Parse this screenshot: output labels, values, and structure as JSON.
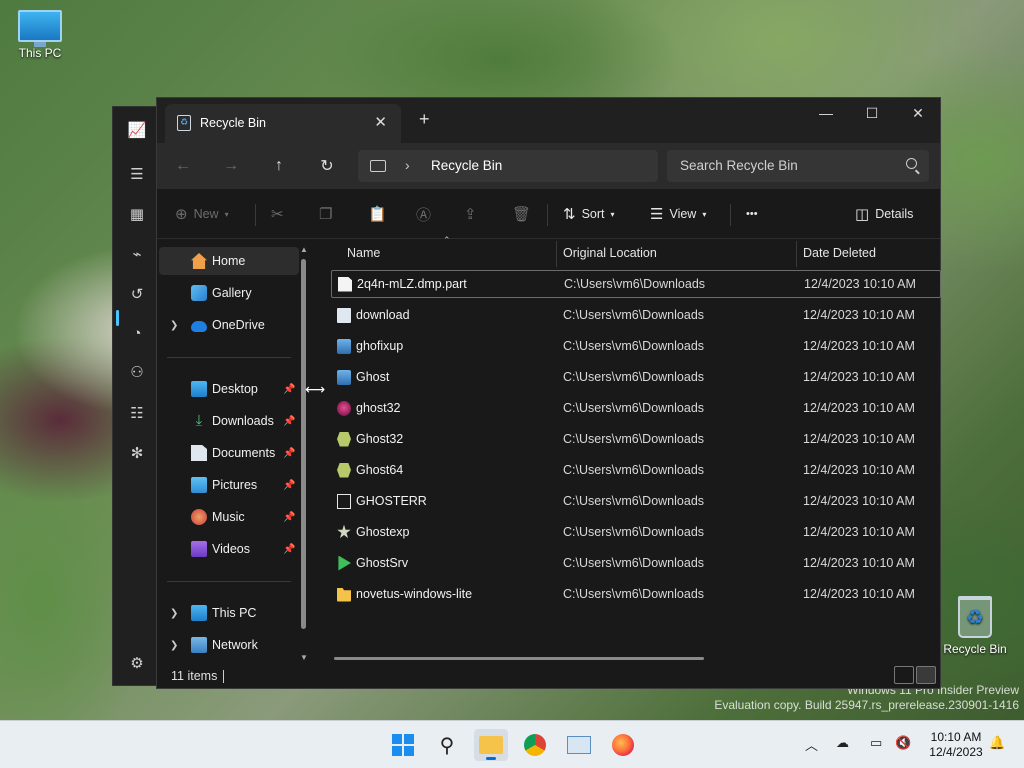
{
  "desktop": {
    "icons": [
      {
        "label": "This PC",
        "icon": "monitor-icon"
      },
      {
        "label": "Recycle Bin",
        "icon": "recycle-bin-icon"
      }
    ]
  },
  "watermark": {
    "line1": "Windows 11 Pro Insider Preview",
    "line2": "Evaluation copy. Build 25947.rs_prerelease.230901-1416"
  },
  "explorer": {
    "tab_title": "Recycle Bin",
    "address": {
      "location": "Recycle Bin"
    },
    "search_placeholder": "Search Recycle Bin",
    "toolbar": {
      "new_label": "New",
      "sort_label": "Sort",
      "view_label": "View",
      "more_label": "•••",
      "details_label": "Details"
    },
    "nav": {
      "items": [
        {
          "label": "Home",
          "icon": "home-icon",
          "active": true
        },
        {
          "label": "Gallery",
          "icon": "gallery-icon"
        },
        {
          "label": "OneDrive",
          "icon": "onedrive-icon",
          "expandable": true
        },
        {
          "label": "Desktop",
          "icon": "desktop-icon",
          "pinned": true
        },
        {
          "label": "Downloads",
          "icon": "downloads-icon",
          "pinned": true
        },
        {
          "label": "Documents",
          "icon": "documents-icon",
          "pinned": true
        },
        {
          "label": "Pictures",
          "icon": "pictures-icon",
          "pinned": true
        },
        {
          "label": "Music",
          "icon": "music-icon",
          "pinned": true
        },
        {
          "label": "Videos",
          "icon": "videos-icon",
          "pinned": true
        },
        {
          "label": "This PC",
          "icon": "this-pc-icon",
          "expandable": true
        },
        {
          "label": "Network",
          "icon": "network-icon",
          "expandable": true
        }
      ]
    },
    "columns": {
      "name": "Name",
      "location": "Original Location",
      "date": "Date Deleted"
    },
    "files": [
      {
        "name": "2q4n-mLZ.dmp.part",
        "location": "C:\\Users\\vm6\\Downloads",
        "date": "12/4/2023 10:10 AM",
        "icon": "file-icon"
      },
      {
        "name": "download",
        "location": "C:\\Users\\vm6\\Downloads",
        "date": "12/4/2023 10:10 AM",
        "icon": "exe-icon"
      },
      {
        "name": "ghofixup",
        "location": "C:\\Users\\vm6\\Downloads",
        "date": "12/4/2023 10:10 AM",
        "icon": "app-icon"
      },
      {
        "name": "Ghost",
        "location": "C:\\Users\\vm6\\Downloads",
        "date": "12/4/2023 10:10 AM",
        "icon": "app-icon"
      },
      {
        "name": "ghost32",
        "location": "C:\\Users\\vm6\\Downloads",
        "date": "12/4/2023 10:10 AM",
        "icon": "ghost-pink-icon"
      },
      {
        "name": "Ghost32",
        "location": "C:\\Users\\vm6\\Downloads",
        "date": "12/4/2023 10:10 AM",
        "icon": "ghost-green-icon"
      },
      {
        "name": "Ghost64",
        "location": "C:\\Users\\vm6\\Downloads",
        "date": "12/4/2023 10:10 AM",
        "icon": "ghost-green-icon"
      },
      {
        "name": "GHOSTERR",
        "location": "C:\\Users\\vm6\\Downloads",
        "date": "12/4/2023 10:10 AM",
        "icon": "text-file-icon"
      },
      {
        "name": "Ghostexp",
        "location": "C:\\Users\\vm6\\Downloads",
        "date": "12/4/2023 10:10 AM",
        "icon": "star-icon"
      },
      {
        "name": "GhostSrv",
        "location": "C:\\Users\\vm6\\Downloads",
        "date": "12/4/2023 10:10 AM",
        "icon": "play-icon"
      },
      {
        "name": "novetus-windows-lite",
        "location": "C:\\Users\\vm6\\Downloads",
        "date": "12/4/2023 10:10 AM",
        "icon": "folder-icon"
      }
    ],
    "status": {
      "count": "11 items"
    }
  },
  "taskbar": {
    "clock": {
      "time": "10:10 AM",
      "date": "12/4/2023"
    },
    "pinned": [
      "start-icon",
      "search-icon",
      "file-explorer-icon",
      "chrome-icon",
      "task-manager-icon",
      "firefox-icon"
    ]
  }
}
